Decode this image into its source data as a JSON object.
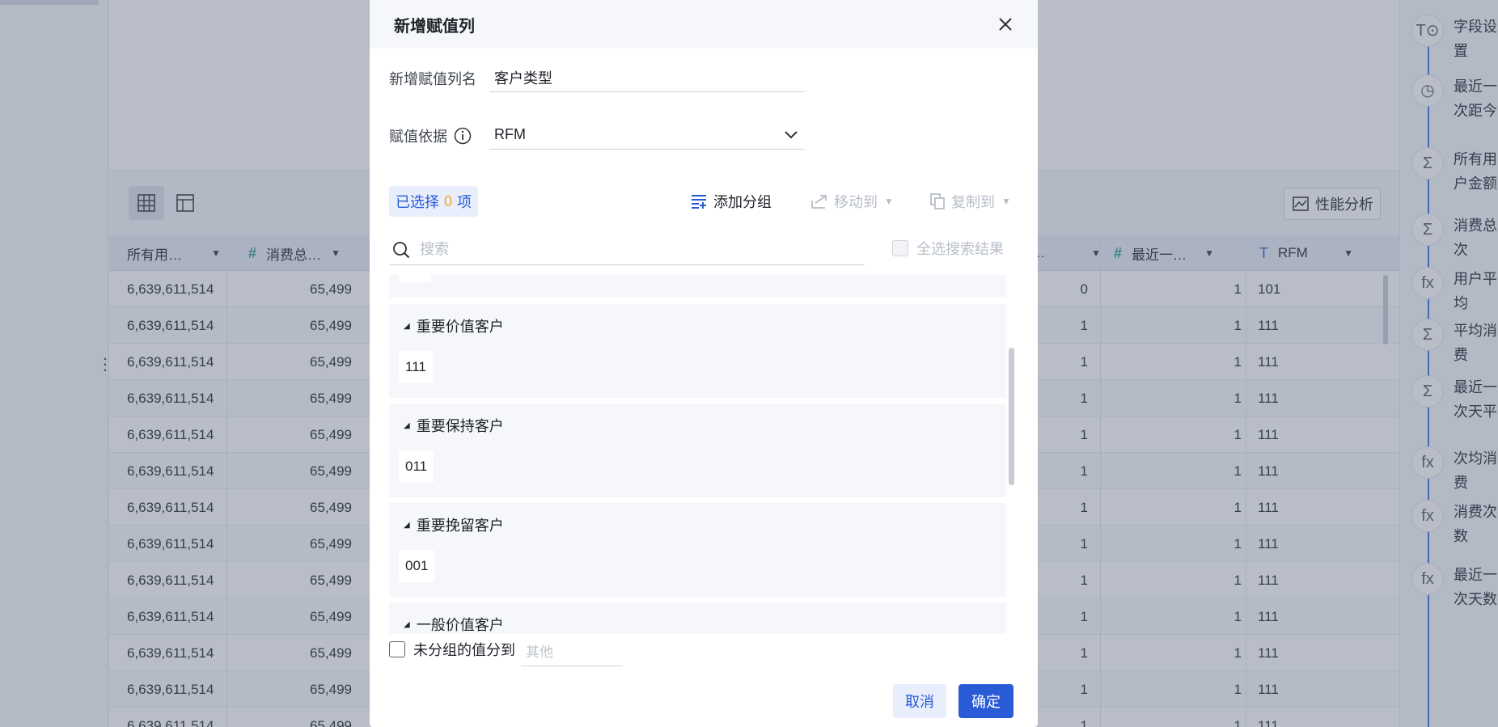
{
  "background": {
    "perf_button_label": "性能分析",
    "table": {
      "columns": [
        {
          "label": "所有用…",
          "type_icon": "hash"
        },
        {
          "label": "消费总…",
          "type_icon": "hash"
        },
        {
          "label": "…",
          "type_icon": "none"
        },
        {
          "label": "最近一…",
          "type_icon": "hash"
        },
        {
          "label": "RFM",
          "type_icon": "text"
        }
      ],
      "rows": [
        {
          "a": "6,639,611,514",
          "b": "65,499",
          "c": "0",
          "d": "1",
          "rfm": "101"
        },
        {
          "a": "6,639,611,514",
          "b": "65,499",
          "c": "1",
          "d": "1",
          "rfm": "111"
        },
        {
          "a": "6,639,611,514",
          "b": "65,499",
          "c": "1",
          "d": "1",
          "rfm": "111"
        },
        {
          "a": "6,639,611,514",
          "b": "65,499",
          "c": "1",
          "d": "1",
          "rfm": "111"
        },
        {
          "a": "6,639,611,514",
          "b": "65,499",
          "c": "1",
          "d": "1",
          "rfm": "111"
        },
        {
          "a": "6,639,611,514",
          "b": "65,499",
          "c": "1",
          "d": "1",
          "rfm": "111"
        },
        {
          "a": "6,639,611,514",
          "b": "65,499",
          "c": "1",
          "d": "1",
          "rfm": "111"
        },
        {
          "a": "6,639,611,514",
          "b": "65,499",
          "c": "1",
          "d": "1",
          "rfm": "111"
        },
        {
          "a": "6,639,611,514",
          "b": "65,499",
          "c": "1",
          "d": "1",
          "rfm": "111"
        },
        {
          "a": "6,639,611,514",
          "b": "65,499",
          "c": "1",
          "d": "1",
          "rfm": "111"
        },
        {
          "a": "6,639,611,514",
          "b": "65,499",
          "c": "1",
          "d": "1",
          "rfm": "111"
        },
        {
          "a": "6,639,611,514",
          "b": "65,499",
          "c": "1",
          "d": "1",
          "rfm": "111"
        },
        {
          "a": "6,639,611,514",
          "b": "65,499",
          "c": "1",
          "d": "1",
          "rfm": "111"
        }
      ]
    },
    "right_panel": [
      {
        "icon": "T⊙",
        "label": "字段设置"
      },
      {
        "icon": "◷",
        "label": "最近一次距今天数"
      },
      {
        "icon": "Σ",
        "label": "所有用户金额"
      },
      {
        "icon": "Σ",
        "label": "消费总次"
      },
      {
        "icon": "fx",
        "label": "用户平均"
      },
      {
        "icon": "Σ",
        "label": "平均消费"
      },
      {
        "icon": "Σ",
        "label": "最近一次天平均数"
      },
      {
        "icon": "fx",
        "label": "次均消费"
      },
      {
        "icon": "fx",
        "label": "消费次数"
      },
      {
        "icon": "fx",
        "label": "最近一次天数评价"
      }
    ]
  },
  "modal": {
    "title": "新增赋值列",
    "name_label": "新增赋值列名",
    "name_value": "客户类型",
    "basis_label": "赋值依据",
    "basis_value": "RFM",
    "selected_prefix": "已选择",
    "selected_count": "0",
    "selected_suffix": "项",
    "actions": {
      "add_group": "添加分组",
      "move_to": "移动到",
      "copy_to": "复制到"
    },
    "search_placeholder": "搜索",
    "select_all_label": "全选搜索结果",
    "groups": [
      {
        "title": "重要价值客户",
        "values": [
          "111"
        ]
      },
      {
        "title": "重要保持客户",
        "values": [
          "011"
        ]
      },
      {
        "title": "重要挽留客户",
        "values": [
          "001"
        ]
      },
      {
        "title": "一般价值客户",
        "values": []
      }
    ],
    "ungrouped_label": "未分组的值分到",
    "ungrouped_placeholder": "其他",
    "cancel_label": "取消",
    "ok_label": "确定"
  }
}
